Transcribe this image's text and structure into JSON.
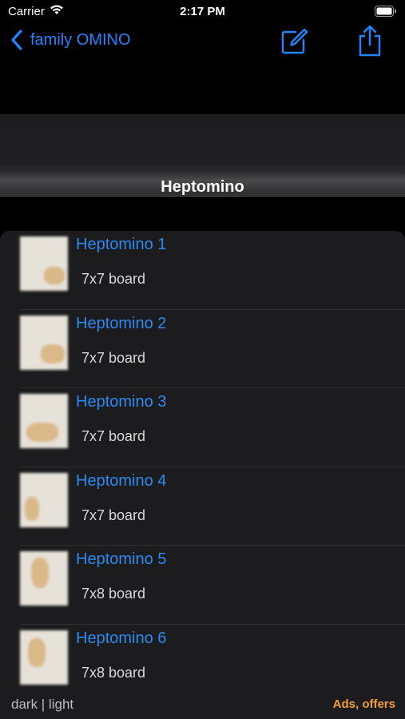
{
  "status_bar": {
    "carrier": "Carrier",
    "time": "2:17 PM"
  },
  "nav": {
    "back_label": "family OMINO",
    "icons": [
      "chevron-left-icon",
      "compose-icon",
      "share-icon"
    ]
  },
  "section": {
    "title": "Heptomino"
  },
  "items": [
    {
      "title": "Heptomino 1",
      "subtitle": "7x7 board"
    },
    {
      "title": "Heptomino 2",
      "subtitle": "7x7 board"
    },
    {
      "title": "Heptomino 3",
      "subtitle": "7x7 board"
    },
    {
      "title": "Heptomino 4",
      "subtitle": "7x7 board"
    },
    {
      "title": "Heptomino 5",
      "subtitle": "7x8 board"
    },
    {
      "title": "Heptomino 6",
      "subtitle": "7x8 board"
    }
  ],
  "footer": {
    "theme_label": "dark | light",
    "ads_label": "Ads, offers"
  },
  "colors": {
    "accent": "#1f86ff",
    "ads": "#f0a030",
    "background": "#000000",
    "card": "#1c1c1e"
  }
}
